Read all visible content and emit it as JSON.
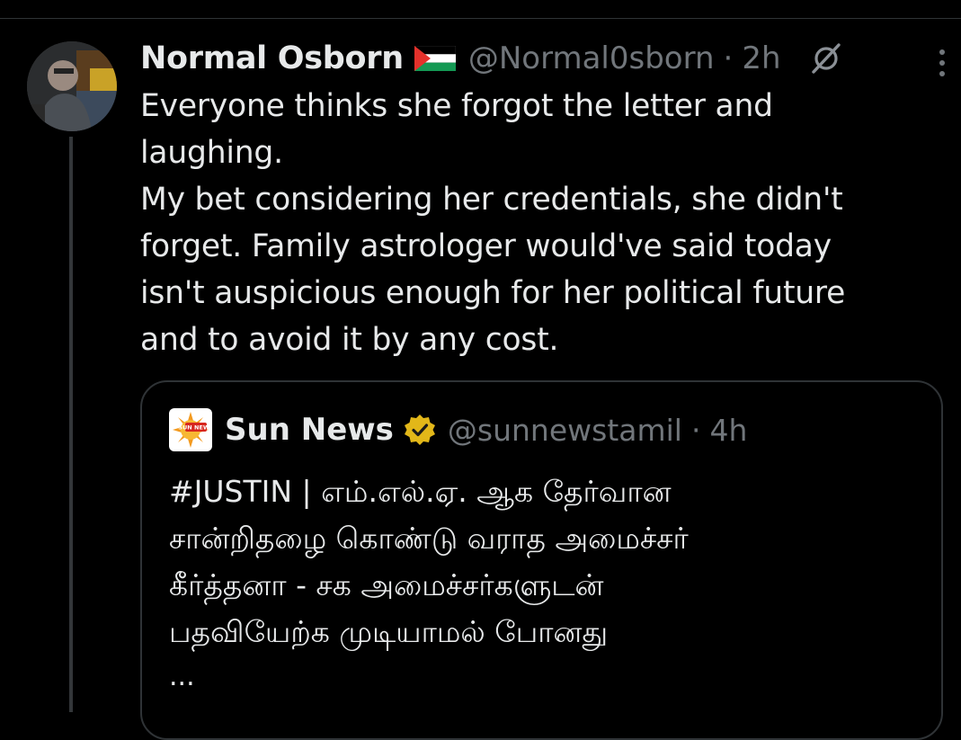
{
  "post": {
    "display_name": "Normal Osborn",
    "flag": "palestine-flag",
    "handle": "@Normal0sborn",
    "separator": "·",
    "time": "2h",
    "text": "Everyone thinks she forgot the letter and\nlaughing.\nMy bet considering her credentials, she didn't\nforget. Family astrologer would've said today\nisn't auspicious enough for her political future\nand to avoid it by any cost."
  },
  "quote": {
    "display_name": "Sun News",
    "logo_text": "SUN NEWS",
    "verified": "gold-verified-badge",
    "handle": "@sunnewstamil",
    "separator": "·",
    "time": "4h",
    "text": "#JUSTIN | எம்.எல்.ஏ. ஆக தேர்வான\nசான்றிதழை கொண்டு வராத அமைச்சர்\nகீர்த்தனா - சக அமைச்சர்களுடன்\nபதவியேற்க முடியாமல் போனது",
    "ellipsis": "..."
  },
  "colors": {
    "background": "#000000",
    "text_primary": "#e7e9ea",
    "text_secondary": "#71767b",
    "border": "#2f3336",
    "verified_gold": "#e2b719"
  },
  "icons": {
    "grok": "grok-icon",
    "more": "more-vertical-icon"
  }
}
